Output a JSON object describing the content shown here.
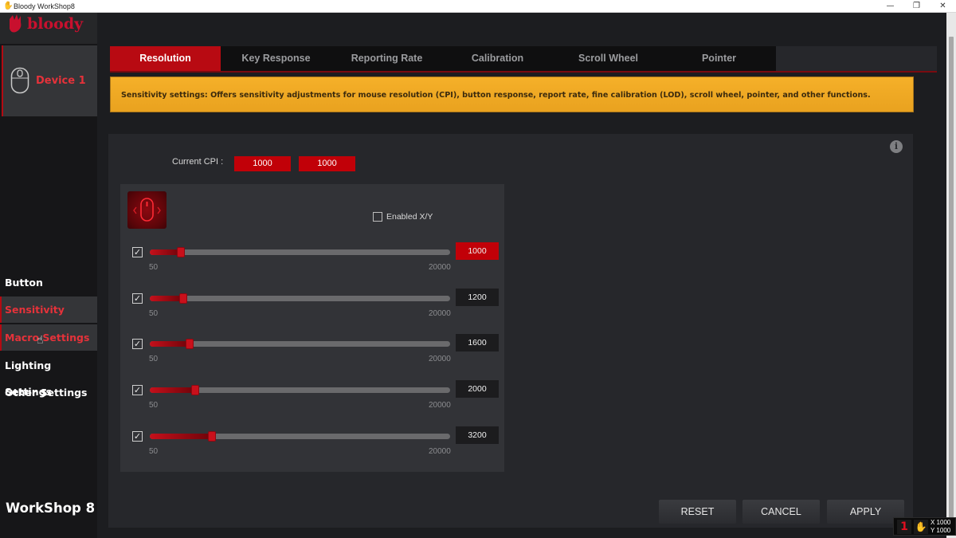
{
  "window": {
    "title": "Bloody WorkShop8",
    "controls": {
      "minimize": "—",
      "restore": "❐",
      "close": "✕"
    }
  },
  "sidebar": {
    "logo_text": "bloody",
    "device_label": "Device 1",
    "items": [
      {
        "label": "Button",
        "active": false
      },
      {
        "label": "Sensitivity",
        "active": true
      },
      {
        "label": "Macro Settings",
        "active": true
      },
      {
        "label": "Lighting Settings",
        "active": false
      },
      {
        "label": "Other Settings",
        "active": false
      }
    ],
    "footer": "WorkShop 8"
  },
  "tabs": [
    {
      "label": "Resolution",
      "active": true
    },
    {
      "label": "Key Response",
      "active": false
    },
    {
      "label": "Reporting Rate",
      "active": false
    },
    {
      "label": "Calibration",
      "active": false
    },
    {
      "label": "Scroll Wheel",
      "active": false
    },
    {
      "label": "Pointer",
      "active": false
    }
  ],
  "banner": "Sensitivity settings: Offers sensitivity adjustments for mouse resolution (CPI), button response, report rate, fine calibration (LOD), scroll wheel, pointer, and other functions.",
  "resolution": {
    "current_cpi_label": "Current CPI :",
    "current_cpi_x": "1000",
    "current_cpi_y": "1000",
    "enabled_xy_label": "Enabled X/Y",
    "enabled_xy_checked": false,
    "min": 50,
    "max": 20000,
    "min_label": "50",
    "max_label": "20000",
    "levels": [
      {
        "value": 1000,
        "display": "1000",
        "checked": true,
        "active": true
      },
      {
        "value": 1200,
        "display": "1200",
        "checked": true,
        "active": false
      },
      {
        "value": 1600,
        "display": "1600",
        "checked": true,
        "active": false
      },
      {
        "value": 2000,
        "display": "2000",
        "checked": true,
        "active": false
      },
      {
        "value": 3200,
        "display": "3200",
        "checked": true,
        "active": false
      }
    ]
  },
  "buttons": {
    "reset": "RESET",
    "cancel": "CANCEL",
    "apply": "APPLY"
  },
  "tray": {
    "level": "1",
    "x_readout": "X 1000",
    "y_readout": "Y 1000"
  },
  "icons": {
    "check": "✓",
    "info": "i",
    "cursor": "☝",
    "app": "✋"
  },
  "colors": {
    "accent": "#b80a12",
    "banner": "#f5b029",
    "active_text": "#e5323a"
  }
}
